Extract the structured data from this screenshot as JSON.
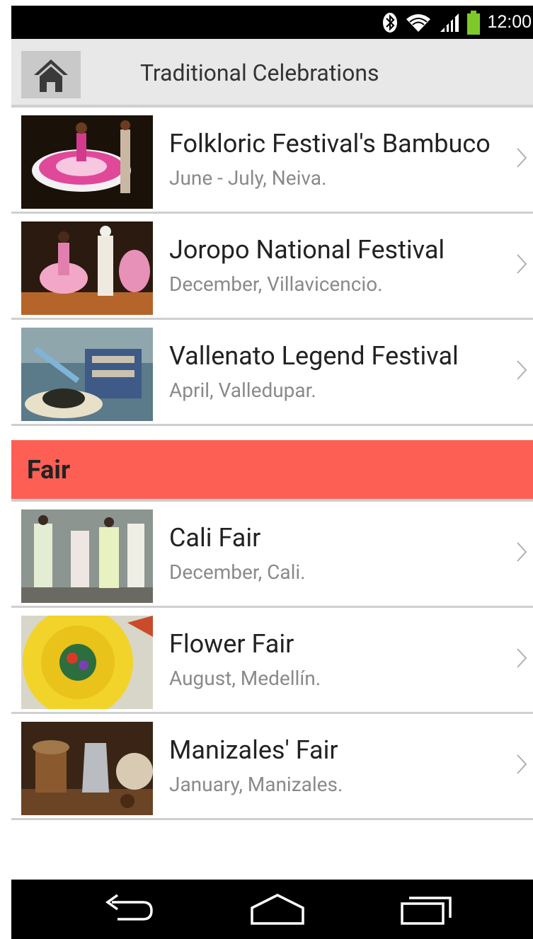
{
  "status_bar": {
    "time": "12:00",
    "icons": [
      "bluetooth-icon",
      "wifi-icon",
      "signal-icon",
      "battery-icon"
    ],
    "battery_color": "#7ec82a"
  },
  "action_bar": {
    "home_icon": "home-icon",
    "title": "Traditional Celebrations"
  },
  "list": {
    "festivals": [
      {
        "title": "Folkloric Festival's Bambuco",
        "subtitle": "June - July, Neiva."
      },
      {
        "title": "Joropo National Festival",
        "subtitle": "December, Villavicencio."
      },
      {
        "title": "Vallenato Legend Festival",
        "subtitle": "April, Valledupar."
      }
    ],
    "section": {
      "label": "Fair",
      "color": "#fe5f55"
    },
    "fairs": [
      {
        "title": "Cali Fair",
        "subtitle": "December, Cali."
      },
      {
        "title": "Flower Fair",
        "subtitle": "August, Medellín."
      },
      {
        "title": "Manizales' Fair",
        "subtitle": "January, Manizales."
      }
    ]
  },
  "nav_bar": {
    "buttons": [
      "back-icon",
      "home-outline-icon",
      "recent-apps-icon"
    ]
  }
}
